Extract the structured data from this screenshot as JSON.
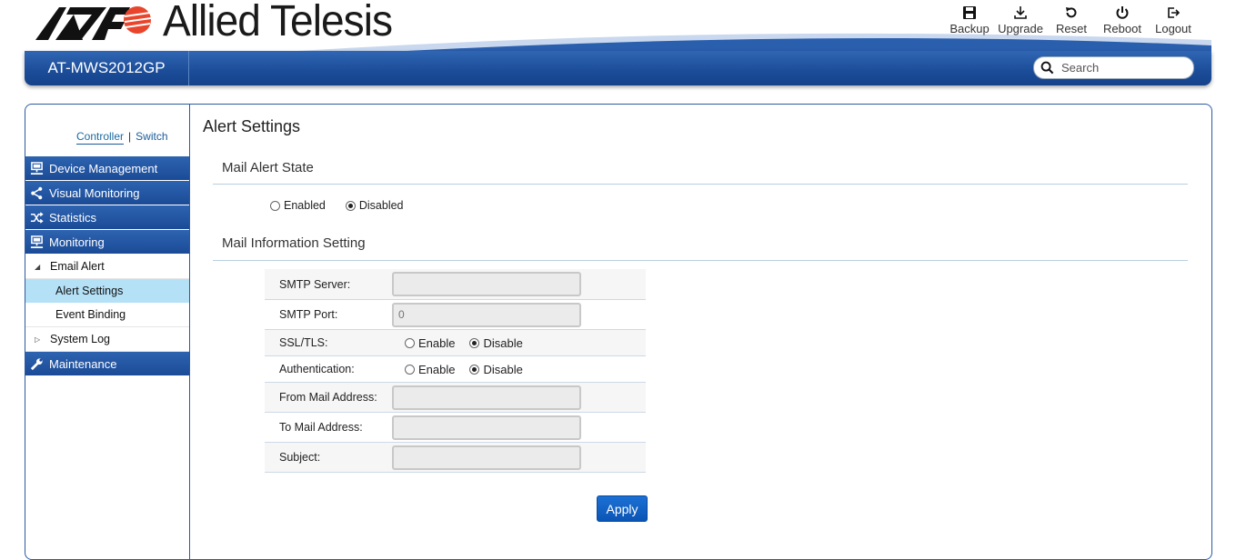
{
  "brand": {
    "name": "Allied Telesis",
    "tm": "™",
    "model": "AT-MWS2012GP"
  },
  "toolbar": [
    {
      "label": "Backup",
      "icon": "save-icon"
    },
    {
      "label": "Upgrade",
      "icon": "download-icon"
    },
    {
      "label": "Reset",
      "icon": "reset-icon"
    },
    {
      "label": "Reboot",
      "icon": "power-icon"
    },
    {
      "label": "Logout",
      "icon": "logout-icon"
    }
  ],
  "search": {
    "placeholder": "Search"
  },
  "switcher": {
    "controller": "Controller",
    "sep": "|",
    "switch": "Switch"
  },
  "sidebar": {
    "items": [
      {
        "label": "Device Management",
        "icon": "device-icon"
      },
      {
        "label": "Visual Monitoring",
        "icon": "share-icon"
      },
      {
        "label": "Statistics",
        "icon": "shuffle-icon"
      },
      {
        "label": "Monitoring",
        "icon": "monitor-icon"
      }
    ],
    "email_alert": "Email Alert",
    "alert_settings": "Alert Settings",
    "event_binding": "Event Binding",
    "system_log": "System Log",
    "maintenance": "Maintenance"
  },
  "page": {
    "title": "Alert Settings",
    "mail_alert_state": "Mail Alert State",
    "state_enabled": "Enabled",
    "state_disabled": "Disabled",
    "mail_info": "Mail Information Setting",
    "smtp_server": "SMTP Server:",
    "smtp_port": "SMTP Port:",
    "smtp_port_placeholder": "0",
    "ssl_tls": "SSL/TLS:",
    "authentication": "Authentication:",
    "enable": "Enable",
    "disable": "Disable",
    "from_mail": "From Mail Address:",
    "to_mail": "To Mail Address:",
    "subject": "Subject:",
    "apply": "Apply"
  },
  "colors": {
    "nav_blue": "#1b4c98",
    "selected": "#b5e1f7",
    "brand_red": "#e8452c"
  }
}
